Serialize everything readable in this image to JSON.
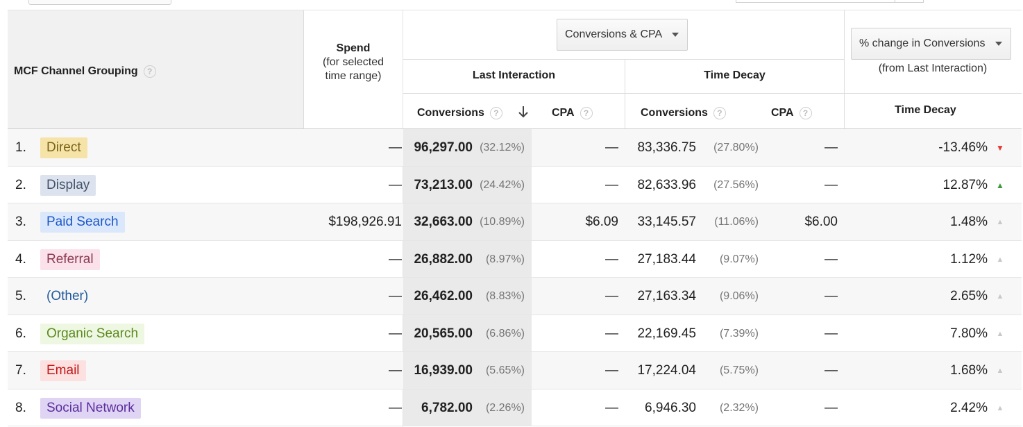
{
  "header": {
    "channel_grouping_label": "MCF Channel Grouping",
    "spend_label": "Spend",
    "spend_sub": "(for selected time range)",
    "metric_dropdown": "Conversions & CPA",
    "comparison_dropdown": "% change in Conversions",
    "comparison_sub": "(from Last Interaction)",
    "last_interaction_label": "Last Interaction",
    "time_decay_label": "Time Decay",
    "conversions_label": "Conversions",
    "cpa_label": "CPA",
    "time_decay_change_label": "Time Decay",
    "help_glyph": "?"
  },
  "colors": {
    "up": "#3c9a3c",
    "down": "#e53935",
    "neutral": "#c8c8c8"
  },
  "rows": [
    {
      "rank": "1.",
      "channel": "Direct",
      "chip_bg": "#f5e3a8",
      "chip_fg": "#7a6418",
      "spend": "—",
      "li_conv": "96,297.00",
      "li_pct": "(32.12%)",
      "li_cpa": "—",
      "td_conv": "83,336.75",
      "td_pct": "(27.80%)",
      "td_cpa": "—",
      "change": "-13.46%",
      "trend": "down"
    },
    {
      "rank": "2.",
      "channel": "Display",
      "chip_bg": "#dce3ee",
      "chip_fg": "#43536b",
      "spend": "—",
      "li_conv": "73,213.00",
      "li_pct": "(24.42%)",
      "li_cpa": "—",
      "td_conv": "82,633.96",
      "td_pct": "(27.56%)",
      "td_cpa": "—",
      "change": "12.87%",
      "trend": "up"
    },
    {
      "rank": "3.",
      "channel": "Paid Search",
      "chip_bg": "#dbe8fb",
      "chip_fg": "#1a56c9",
      "spend": "$198,926.91",
      "li_conv": "32,663.00",
      "li_pct": "(10.89%)",
      "li_cpa": "$6.09",
      "td_conv": "33,145.57",
      "td_pct": "(11.06%)",
      "td_cpa": "$6.00",
      "change": "1.48%",
      "trend": "neutral"
    },
    {
      "rank": "4.",
      "channel": "Referral",
      "chip_bg": "#fbe1ea",
      "chip_fg": "#8a3a52",
      "spend": "—",
      "li_conv": "26,882.00",
      "li_pct": "(8.97%)",
      "li_cpa": "—",
      "td_conv": "27,183.44",
      "td_pct": "(9.07%)",
      "td_cpa": "—",
      "change": "1.12%",
      "trend": "neutral"
    },
    {
      "rank": "5.",
      "channel": "(Other)",
      "chip_bg": "transparent",
      "chip_fg": "#1f5a9c",
      "spend": "—",
      "li_conv": "26,462.00",
      "li_pct": "(8.83%)",
      "li_cpa": "—",
      "td_conv": "27,163.34",
      "td_pct": "(9.06%)",
      "td_cpa": "—",
      "change": "2.65%",
      "trend": "neutral"
    },
    {
      "rank": "6.",
      "channel": "Organic Search",
      "chip_bg": "#eef7e2",
      "chip_fg": "#5a8a1e",
      "spend": "—",
      "li_conv": "20,565.00",
      "li_pct": "(6.86%)",
      "li_cpa": "—",
      "td_conv": "22,169.45",
      "td_pct": "(7.39%)",
      "td_cpa": "—",
      "change": "7.80%",
      "trend": "neutral"
    },
    {
      "rank": "7.",
      "channel": "Email",
      "chip_bg": "#fde0e0",
      "chip_fg": "#c21818",
      "spend": "—",
      "li_conv": "16,939.00",
      "li_pct": "(5.65%)",
      "li_cpa": "—",
      "td_conv": "17,224.04",
      "td_pct": "(5.75%)",
      "td_cpa": "—",
      "change": "1.68%",
      "trend": "neutral"
    },
    {
      "rank": "8.",
      "channel": "Social Network",
      "chip_bg": "#e0d4f5",
      "chip_fg": "#5a2e9c",
      "spend": "—",
      "li_conv": "6,782.00",
      "li_pct": "(2.26%)",
      "li_cpa": "—",
      "td_conv": "6,946.30",
      "td_pct": "(2.32%)",
      "td_cpa": "—",
      "change": "2.42%",
      "trend": "neutral"
    }
  ]
}
